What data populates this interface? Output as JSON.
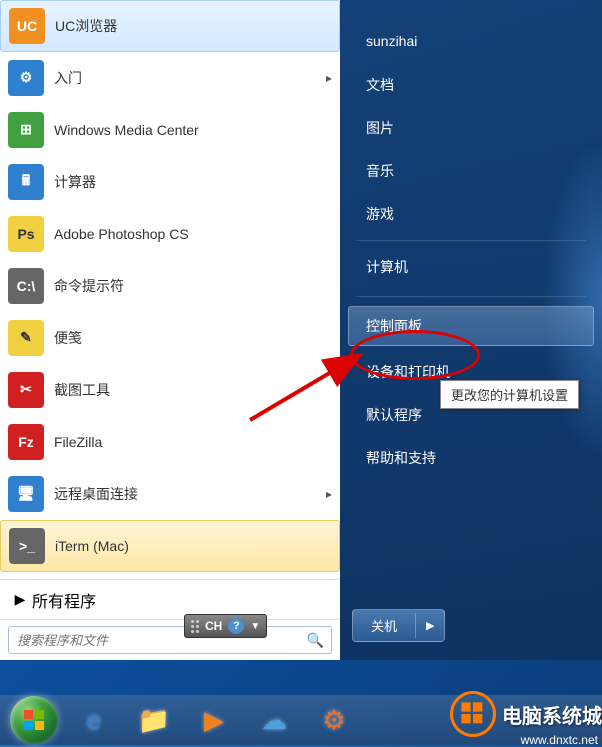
{
  "left_panel": {
    "programs": [
      {
        "label": "UC浏览器",
        "icon_name": "uc-browser-icon",
        "icon_class": "icon-orange",
        "glyph": "UC"
      },
      {
        "label": "入门",
        "icon_name": "getting-started-icon",
        "icon_class": "icon-blue",
        "glyph": "⚙",
        "submenu": true
      },
      {
        "label": "Windows Media Center",
        "icon_name": "media-center-icon",
        "icon_class": "icon-green",
        "glyph": "⊞"
      },
      {
        "label": "计算器",
        "icon_name": "calculator-icon",
        "icon_class": "icon-blue",
        "glyph": "🖩"
      },
      {
        "label": "Adobe Photoshop CS",
        "icon_name": "photoshop-icon",
        "icon_class": "icon-yellow",
        "glyph": "Ps"
      },
      {
        "label": "命令提示符",
        "icon_name": "cmd-icon",
        "icon_class": "icon-gray",
        "glyph": "C:\\"
      },
      {
        "label": "便笺",
        "icon_name": "sticky-notes-icon",
        "icon_class": "icon-yellow",
        "glyph": "✎"
      },
      {
        "label": "截图工具",
        "icon_name": "snipping-tool-icon",
        "icon_class": "icon-red",
        "glyph": "✂"
      },
      {
        "label": "FileZilla",
        "icon_name": "filezilla-icon",
        "icon_class": "icon-red",
        "glyph": "Fz"
      },
      {
        "label": "远程桌面连接",
        "icon_name": "remote-desktop-icon",
        "icon_class": "icon-blue",
        "glyph": "🖥",
        "submenu": true
      },
      {
        "label": "iTerm (Mac)",
        "icon_name": "iterm-icon",
        "icon_class": "icon-gray",
        "glyph": ">_",
        "highlighted": true
      }
    ],
    "all_programs_label": "所有程序",
    "search_placeholder": "搜索程序和文件"
  },
  "right_panel": {
    "username": "sunzihai",
    "items_top": [
      "文档",
      "图片",
      "音乐",
      "游戏",
      "计算机"
    ],
    "control_panel": "控制面板",
    "items_bottom": [
      "设备和打印机",
      "默认程序",
      "帮助和支持"
    ],
    "shutdown_label": "关机"
  },
  "tooltip_text": "更改您的计算机设置",
  "ime": {
    "label": "CH",
    "help": "?"
  },
  "taskbar": {
    "items": [
      {
        "name": "ie-icon",
        "glyph": "e",
        "color": "#2a7fd8"
      },
      {
        "name": "explorer-icon",
        "glyph": "📁",
        "color": "#f0c050"
      },
      {
        "name": "media-player-icon",
        "glyph": "▶",
        "color": "#f08020"
      },
      {
        "name": "cloud-icon",
        "glyph": "☁",
        "color": "#4da0e0"
      },
      {
        "name": "settings-icon",
        "glyph": "⚙",
        "color": "#f07020"
      }
    ]
  },
  "watermark": {
    "brand": "电脑系统城",
    "url": "www.dnxtc.net"
  }
}
